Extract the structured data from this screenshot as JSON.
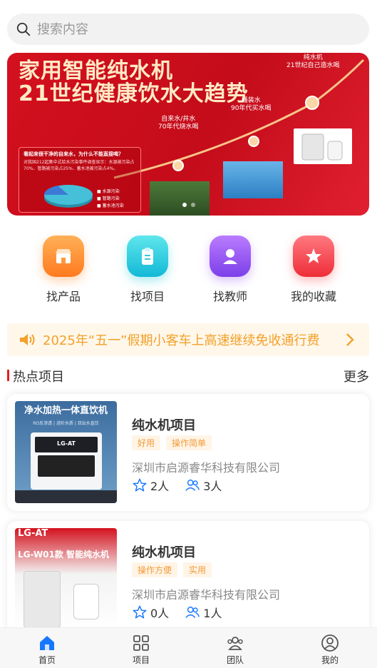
{
  "search": {
    "placeholder": "搜索内容"
  },
  "banner": {
    "headline1": "家用智能纯水机",
    "headline2": "21世纪健康饮水大趋势",
    "milestones": [
      {
        "title": "自来水/井水",
        "sub": "70年代烧水喝"
      },
      {
        "title": "桶装水",
        "sub": "90年代买水喝"
      },
      {
        "title": "纯水机",
        "sub": "21世纪自己造水喝"
      }
    ],
    "info_question": "看起来很干净的自来水，为什么不能直接喝？",
    "info_detail": "对我国212起集中式给水污染事件调查显示：水源被污染占70%、管路被污染占25%、蓄水池被污染占4%。",
    "legend": [
      "水源污染",
      "管路污染",
      "蓄水池污染"
    ]
  },
  "nav": [
    {
      "label": "找产品",
      "icon": "shop-icon",
      "color": "#ff8a2a"
    },
    {
      "label": "找项目",
      "icon": "clipboard-icon",
      "color": "#20c8d8"
    },
    {
      "label": "找教师",
      "icon": "user-icon",
      "color": "#9b5cf0"
    },
    {
      "label": "我的收藏",
      "icon": "star-icon",
      "color": "#f5444a"
    }
  ],
  "notice": {
    "text": "2025年“五一”假期小客车上高速继续免收通行费",
    "color": "#f2a12a"
  },
  "section": {
    "title": "热点项目",
    "more": "更多"
  },
  "projects": [
    {
      "name": "纯水机项目",
      "tags": [
        "好用",
        "操作简单"
      ],
      "company": "深圳市启源睿华科技有限公司",
      "favorites": "2人",
      "members": "3人",
      "thumb_title": "净水加热一体直饮机",
      "thumb_sub": "RO反渗透 | 进阶水质 | 双出水直饮",
      "thumb_brand": "LG-AT"
    },
    {
      "name": "纯水机项目",
      "tags": [
        "操作方便",
        "实用"
      ],
      "company": "深圳市启源睿华科技有限公司",
      "favorites": "0人",
      "members": "1人",
      "thumb_brand": "LG-AT",
      "thumb_title": "LG-W01款 智能纯水机"
    }
  ],
  "tabbar": [
    {
      "label": "首页",
      "icon": "home-icon",
      "active": true
    },
    {
      "label": "项目",
      "icon": "grid-icon",
      "active": false
    },
    {
      "label": "团队",
      "icon": "team-icon",
      "active": false
    },
    {
      "label": "我的",
      "icon": "profile-icon",
      "active": false
    }
  ],
  "colors": {
    "accent": "#1677ff",
    "brand_red": "#d4101e",
    "tag_text": "#f29c3a"
  }
}
